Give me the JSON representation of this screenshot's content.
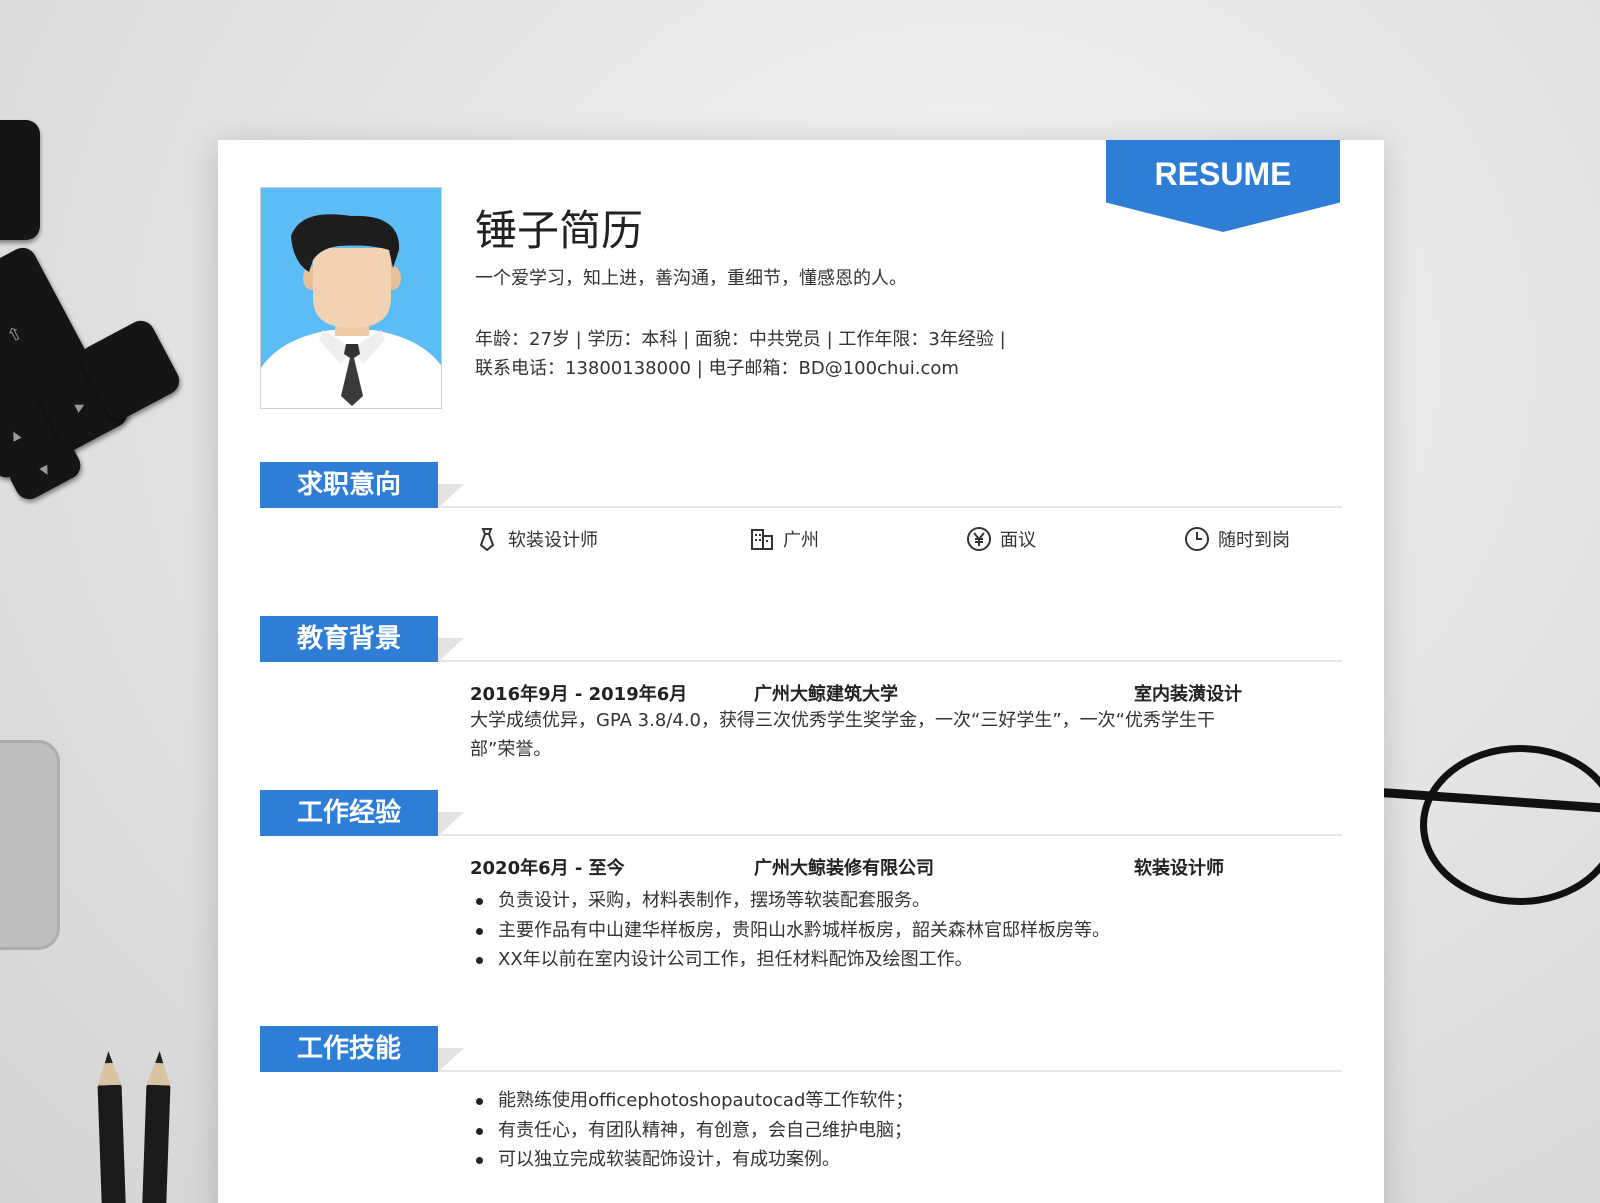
{
  "ribbon": {
    "label": "RESUME"
  },
  "profile": {
    "name": "锤子简历",
    "motto": "一个爱学习，知上进，善沟通，重细节，懂感恩的人。",
    "info_line1": "年龄：27岁 | 学历：本科 | 面貌：中共党员 | 工作年限：3年经验 |",
    "info_line2": "联系电话：13800138000 | 电子邮箱：BD@100chui.com"
  },
  "sections": {
    "intent": {
      "title": "求职意向",
      "items": [
        {
          "icon": "tie-icon",
          "label": "软装设计师"
        },
        {
          "icon": "building-icon",
          "label": "广州"
        },
        {
          "icon": "yen-icon",
          "label": "面议"
        },
        {
          "icon": "clock-icon",
          "label": "随时到岗"
        }
      ]
    },
    "education": {
      "title": "教育背景",
      "date": "2016年9月 - 2019年6月",
      "school": "广州大鲸建筑大学",
      "major": "室内装潢设计",
      "desc_line1": "大学成绩优异，GPA 3.8/4.0，获得三次优秀学生奖学金，一次“三好学生”，一次“优秀学生干",
      "desc_line2": "部”荣誉。"
    },
    "work": {
      "title": "工作经验",
      "date": "2020年6月 - 至今",
      "company": "广州大鲸装修有限公司",
      "role": "软装设计师",
      "bullets": [
        "负责设计，采购，材料表制作，摆场等软装配套服务。",
        "主要作品有中山建华样板房，贵阳山水黔城样板房，韶关森林官邸样板房等。",
        "XX年以前在室内设计公司工作，担任材料配饰及绘图工作。"
      ]
    },
    "skills": {
      "title": "工作技能",
      "bullets": [
        " 能熟练使用officephotoshopautocad等工作软件；",
        "有责任心，有团队精神，有创意，会自己维护电脑；",
        "可以独立完成软装配饰设计，有成功案例。"
      ]
    }
  },
  "colors": {
    "accent": "#2e7ed8",
    "photo_bg": "#5bbcf6"
  }
}
